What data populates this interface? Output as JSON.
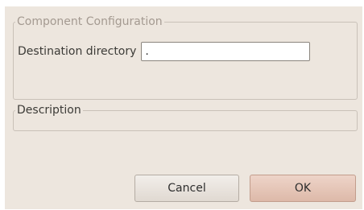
{
  "dialog": {
    "config_group": {
      "title": "Component Configuration",
      "destination_label": "Destination directory",
      "destination_value": "."
    },
    "description_group": {
      "title": "Description"
    },
    "buttons": {
      "cancel_label": "Cancel",
      "ok_label": "OK"
    }
  }
}
